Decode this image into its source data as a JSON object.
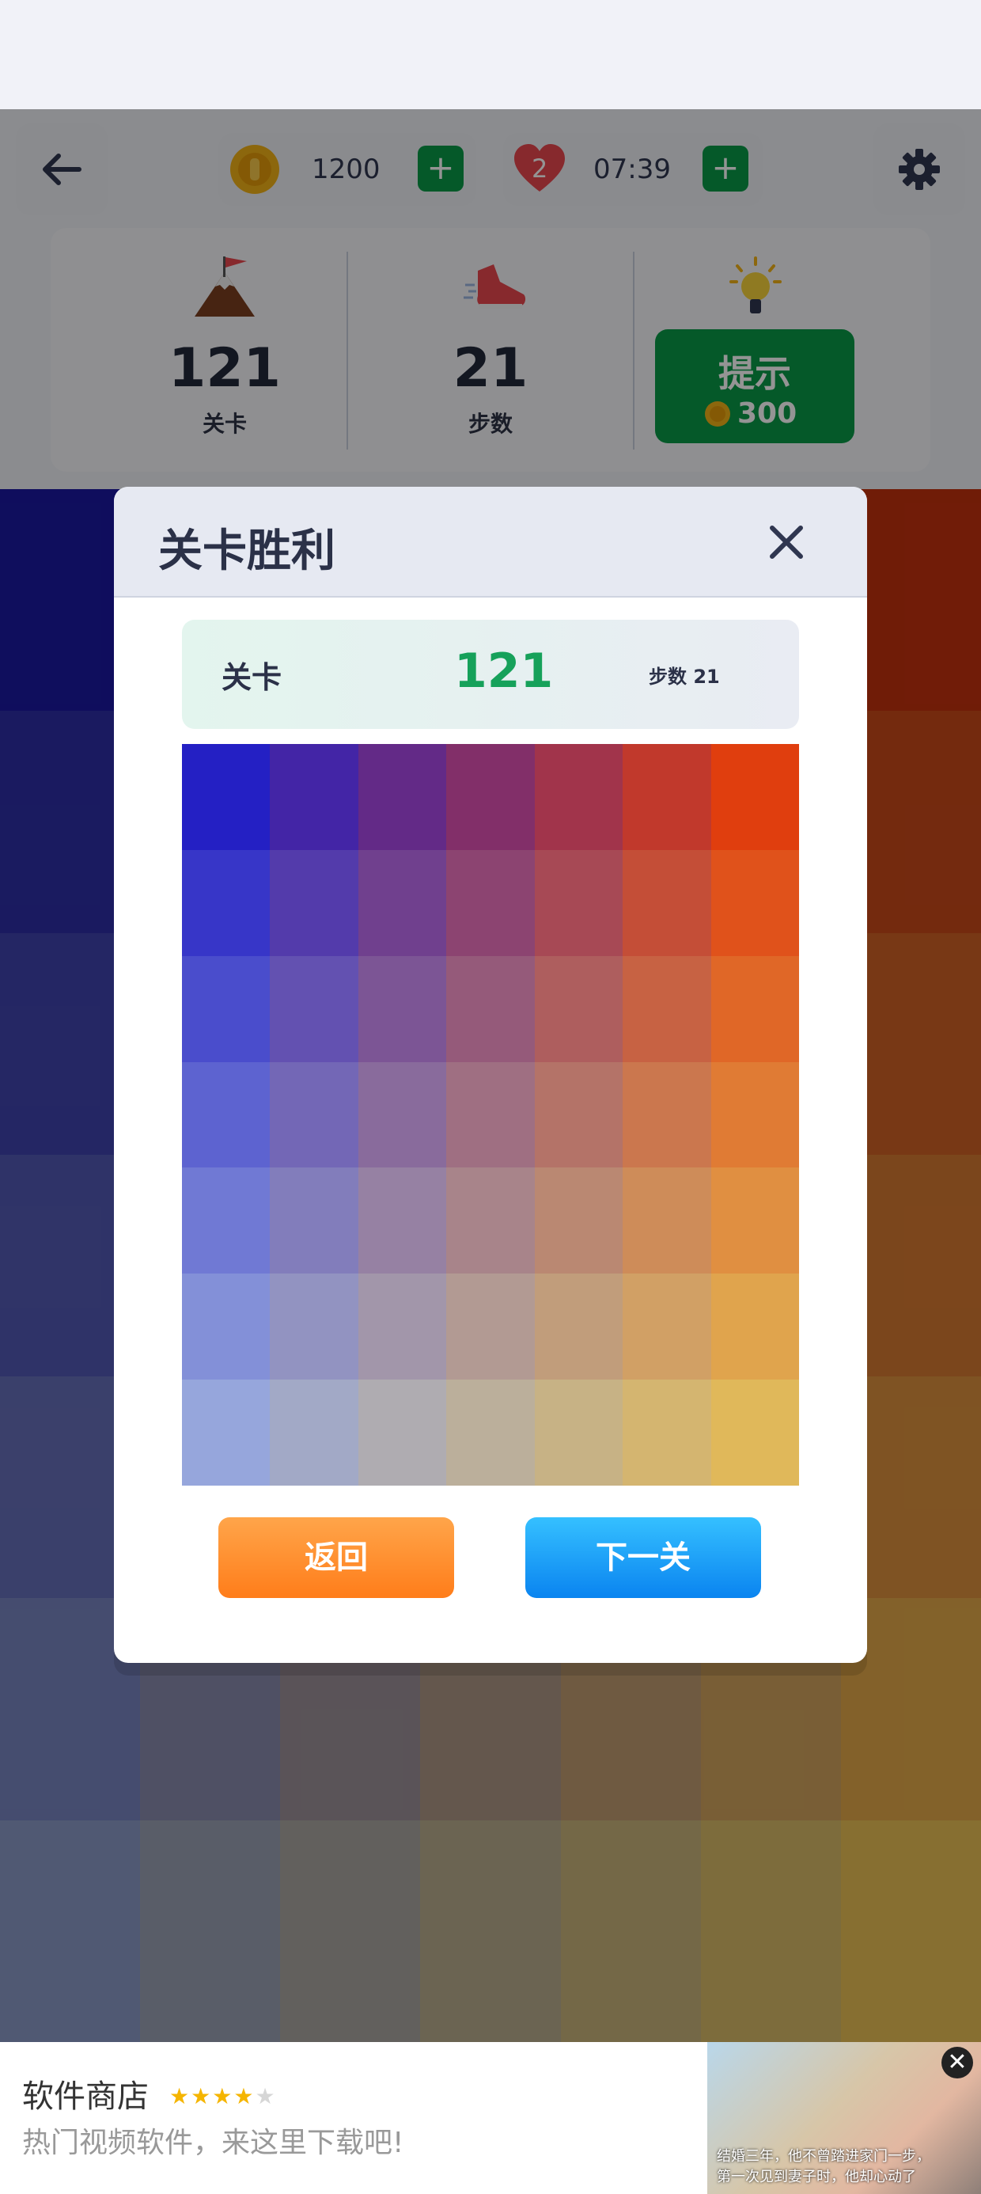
{
  "topbar": {
    "coins": "1200",
    "lives": "2",
    "timer": "07:39"
  },
  "stats": {
    "level_num": "121",
    "level_label": "关卡",
    "steps_num": "21",
    "steps_label": "步数",
    "hint_label": "提示",
    "hint_cost": "300"
  },
  "modal": {
    "title": "关卡胜利",
    "level_label": "关卡",
    "level_num": "121",
    "steps_text": "步数 21",
    "back_label": "返回",
    "next_label": "下一关"
  },
  "ad": {
    "title": "软件商店",
    "rating": 4,
    "rating_max": 5,
    "description": "热门视频软件，来这里下载吧!",
    "caption_line1": "结婚三年，他不曾踏进家门一步，",
    "caption_line2": "第一次见到妻子时，他却心动了"
  },
  "colors": {
    "accent_green": "#0a9a48",
    "next_blue": "#0a84f0",
    "back_orange": "#ff7d1a",
    "heart_red": "#e8484f",
    "coin_gold": "#f2b218"
  },
  "icons": [
    "back-arrow-icon",
    "coin-icon",
    "heart-icon",
    "gear-icon",
    "mountain-flag-icon",
    "sneaker-icon",
    "lightbulb-icon",
    "close-icon"
  ],
  "puzzle": {
    "rows": 7,
    "cols": 7,
    "top_left": "#2420c4",
    "top_right": "#e03e0e",
    "bottom_left": "#96a6dc",
    "bottom_right": "#e0b85a"
  },
  "background_puzzle": {
    "rows": 7,
    "cols": 7,
    "top_left": "#1a18a0",
    "top_right": "#c2310d",
    "bottom_left": "#8a99c6",
    "bottom_right": "#e8c055"
  }
}
